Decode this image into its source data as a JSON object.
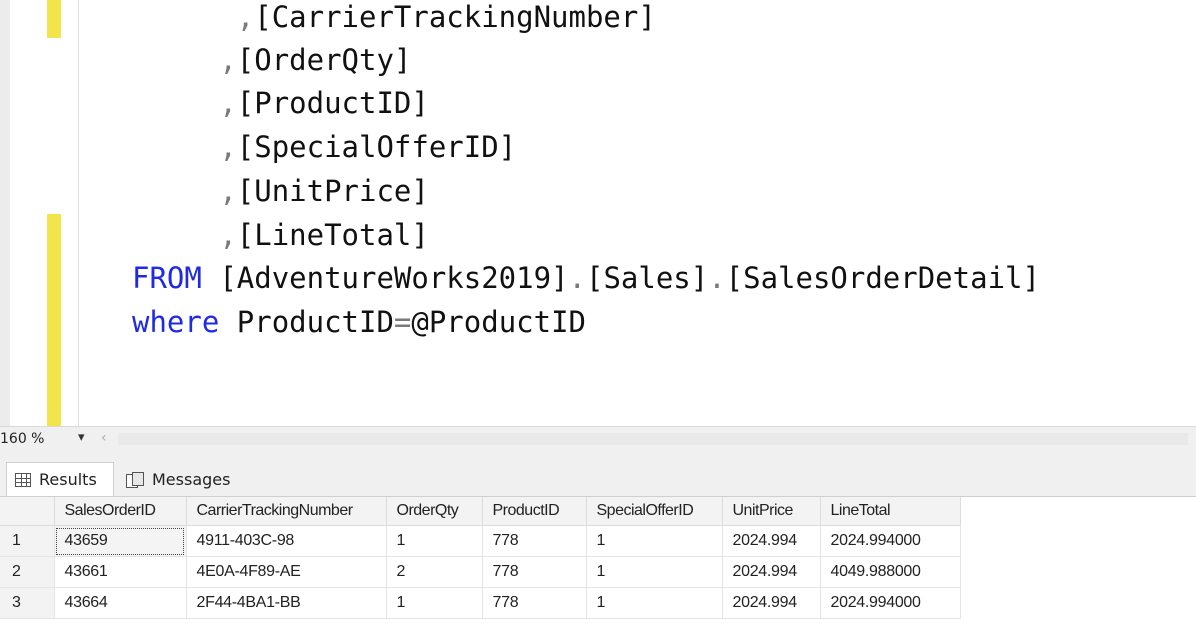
{
  "editor": {
    "lines": [
      {
        "indent": "      ",
        "punct": ",",
        "text": "[CarrierTrackingNumber]"
      },
      {
        "indent": "     ",
        "punct": ",",
        "text": "[OrderQty]"
      },
      {
        "indent": "     ",
        "punct": ",",
        "text": "[ProductID]"
      },
      {
        "indent": "     ",
        "punct": ",",
        "text": "[SpecialOfferID]"
      },
      {
        "indent": "     ",
        "punct": ",",
        "text": "[UnitPrice]"
      },
      {
        "indent": "     ",
        "punct": ",",
        "text": "[LineTotal]"
      }
    ],
    "from_keyword": "FROM",
    "from_db": "[AdventureWorks2019]",
    "from_schema": "[Sales]",
    "from_table": "[SalesOrderDetail]",
    "dot": ".",
    "where_keyword": "where",
    "where_column": "ProductID",
    "where_op": "=",
    "where_param": "@ProductID"
  },
  "zoom": {
    "value": "160 %",
    "dropdown_glyph": "▾",
    "scroll_left_glyph": "‹"
  },
  "tabs": {
    "results": "Results",
    "messages": "Messages"
  },
  "grid": {
    "columns": [
      "SalesOrderID",
      "CarrierTrackingNumber",
      "OrderQty",
      "ProductID",
      "SpecialOfferID",
      "UnitPrice",
      "LineTotal"
    ],
    "rows": [
      {
        "num": "1",
        "cells": [
          "43659",
          "4911-403C-98",
          "1",
          "778",
          "1",
          "2024.994",
          "2024.994000"
        ]
      },
      {
        "num": "2",
        "cells": [
          "43661",
          "4E0A-4F89-AE",
          "2",
          "778",
          "1",
          "2024.994",
          "4049.988000"
        ]
      },
      {
        "num": "3",
        "cells": [
          "43664",
          "2F44-4BA1-BB",
          "1",
          "778",
          "1",
          "2024.994",
          "2024.994000"
        ]
      }
    ]
  },
  "colors": {
    "keyword": "#1f2ae6",
    "change_bar": "#f2e54c"
  }
}
